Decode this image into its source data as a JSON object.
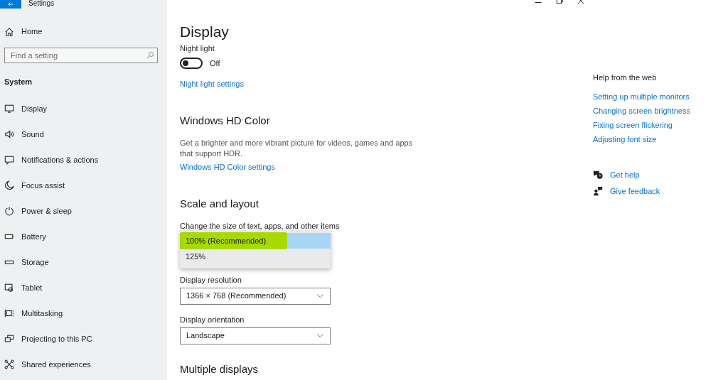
{
  "window": {
    "title": "Settings"
  },
  "sidebar": {
    "home": "Home",
    "search": {
      "placeholder": "Find a setting"
    },
    "section": "System",
    "items": [
      {
        "label": "Display",
        "selected": false
      },
      {
        "label": "Sound",
        "selected": false
      },
      {
        "label": "Notifications & actions",
        "selected": false
      },
      {
        "label": "Focus assist",
        "selected": false
      },
      {
        "label": "Power & sleep",
        "selected": false
      },
      {
        "label": "Battery",
        "selected": false
      },
      {
        "label": "Storage",
        "selected": false
      },
      {
        "label": "Tablet",
        "selected": false
      },
      {
        "label": "Multitasking",
        "selected": false
      },
      {
        "label": "Projecting to this PC",
        "selected": false
      },
      {
        "label": "Shared experiences",
        "selected": false
      }
    ]
  },
  "page": {
    "title": "Display",
    "night_light": {
      "label": "Night light",
      "on": false,
      "state_text": "Off",
      "link": "Night light settings"
    },
    "hd_color": {
      "heading": "Windows HD Color",
      "description": "Get a brighter and more vibrant picture for videos, games and apps that support HDR.",
      "link": "Windows HD Color settings"
    },
    "scale": {
      "heading": "Scale and layout",
      "label": "Change the size of text, apps, and other items",
      "options": [
        {
          "label": "100% (Recommended)",
          "selected": true,
          "highlighted": true
        },
        {
          "label": "125%",
          "selected": false,
          "highlighted": false
        }
      ],
      "resolution": {
        "label": "Display resolution",
        "value": "1366 × 768 (Recommended)"
      },
      "orientation": {
        "label": "Display orientation",
        "value": "Landscape"
      }
    },
    "multiple_displays": {
      "heading": "Multiple displays"
    }
  },
  "help": {
    "heading": "Help from the web",
    "links": [
      "Setting up multiple monitors",
      "Changing screen brightness",
      "Fixing screen flickering",
      "Adjusting font size"
    ],
    "actions": [
      "Get help",
      "Give feedback"
    ]
  }
}
